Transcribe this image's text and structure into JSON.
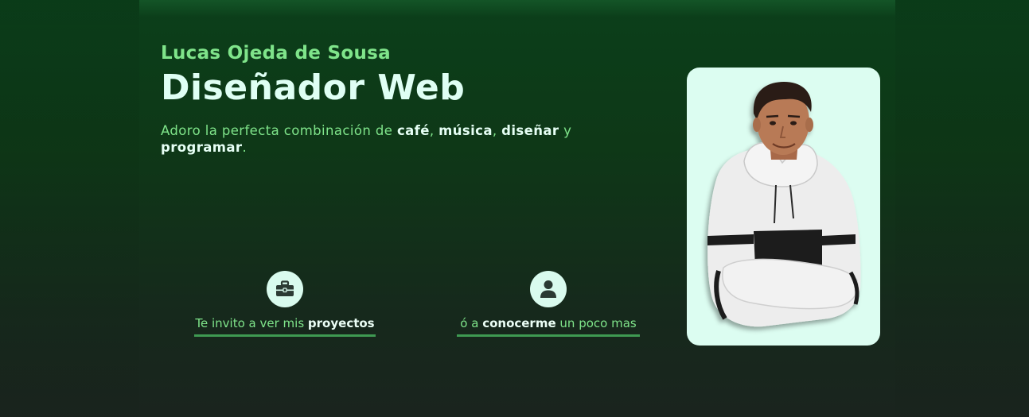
{
  "hero": {
    "name": "Lucas Ojeda de Sousa",
    "role": "Diseñador Web",
    "intro": {
      "t1": "Adoro la perfecta combinación de ",
      "w1": "café",
      "t2": ", ",
      "w2": "música",
      "t3": ", ",
      "w3": "diseñar",
      "t4": " y ",
      "w4": "programar",
      "t5": "."
    }
  },
  "cta_projects": {
    "icon": "briefcase-icon",
    "prefix": "Te invito a ver mis ",
    "highlight": "proyectos"
  },
  "cta_about": {
    "icon": "user-icon",
    "prefix": "ó a ",
    "highlight": "conocerme",
    "suffix": " un poco mas"
  },
  "photo": {
    "card_color": "#dcfdf1"
  },
  "colors": {
    "accent_green": "#7fe48a",
    "heading_mint": "#dffff4",
    "underline_green": "#3f9a52",
    "icon_circle": "#d9fbee",
    "background_top": "#0b3f1a",
    "background_bottom": "#1a241e"
  }
}
